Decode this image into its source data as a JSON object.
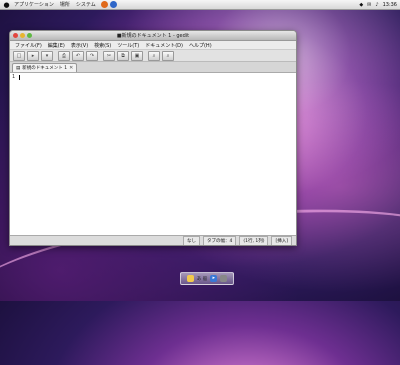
{
  "panel": {
    "menus": [
      "アプリケーション",
      "場所",
      "システム"
    ],
    "right_items": [
      "◆",
      "✉",
      "♪",
      "13:36"
    ]
  },
  "window": {
    "title": "■新規のドキュメント 1 - gedit",
    "menus": [
      "ファイル(F)",
      "編集(E)",
      "表示(V)",
      "検索(S)",
      "ツール(T)",
      "ドキュメント(D)",
      "ヘルプ(H)"
    ],
    "toolbar": [
      "□",
      "▸",
      "▾",
      "⎙",
      "↶",
      "↷",
      "✂",
      "⧉",
      "▣",
      "⌕",
      "⌕"
    ],
    "tab_label": "新規のドキュメント 1",
    "line_number": "1",
    "status": [
      "なし",
      "タブの幅：4",
      "(1行, 1列)",
      "[挿入]"
    ]
  },
  "dock": {
    "label": "あ 般"
  },
  "colors": {
    "close": "#e2463f",
    "minimize": "#e8b52f",
    "zoom": "#5fb943"
  }
}
